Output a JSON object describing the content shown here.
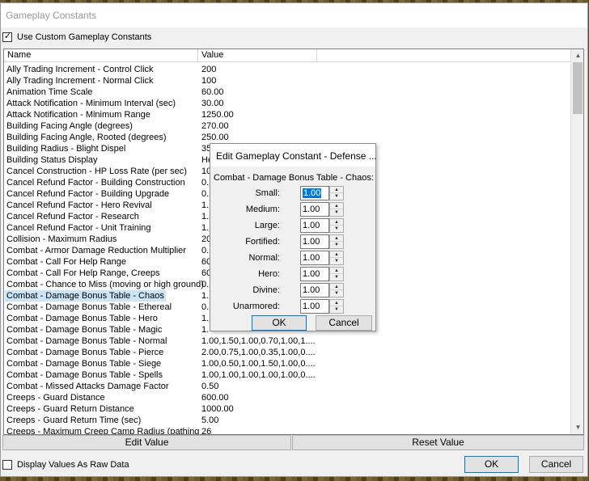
{
  "window": {
    "title": "Gameplay Constants",
    "use_custom_label": "Use Custom Gameplay Constants",
    "use_custom_checked": true,
    "raw_data_label": "Display Values As Raw Data",
    "raw_data_checked": false
  },
  "list": {
    "col_name": "Name",
    "col_value": "Value",
    "rows": [
      {
        "name": "Ally Trading Increment - Control Click",
        "value": "200"
      },
      {
        "name": "Ally Trading Increment - Normal Click",
        "value": "100"
      },
      {
        "name": "Animation Time Scale",
        "value": "60.00"
      },
      {
        "name": "Attack Notification - Minimum Interval (sec)",
        "value": "30.00"
      },
      {
        "name": "Attack Notification - Minimum Range",
        "value": "1250.00"
      },
      {
        "name": "Building Facing Angle (degrees)",
        "value": "270.00"
      },
      {
        "name": "Building Facing Angle, Rooted (degrees)",
        "value": "250.00"
      },
      {
        "name": "Building Radius - Blight Dispel",
        "value": "35"
      },
      {
        "name": "Building Status Display",
        "value": "He"
      },
      {
        "name": "Cancel Construction - HP Loss Rate (per sec)",
        "value": "10"
      },
      {
        "name": "Cancel Refund Factor - Building Construction",
        "value": "0."
      },
      {
        "name": "Cancel Refund Factor - Building Upgrade",
        "value": "0."
      },
      {
        "name": "Cancel Refund Factor - Hero Revival",
        "value": "1."
      },
      {
        "name": "Cancel Refund Factor - Research",
        "value": "1."
      },
      {
        "name": "Cancel Refund Factor - Unit Training",
        "value": "1."
      },
      {
        "name": "Collision - Maximum Radius",
        "value": "20"
      },
      {
        "name": "Combat - Armor Damage Reduction Multiplier",
        "value": "0."
      },
      {
        "name": "Combat - Call For Help Range",
        "value": "60"
      },
      {
        "name": "Combat - Call For Help Range, Creeps",
        "value": "60"
      },
      {
        "name": "Combat - Chance to Miss (moving or high ground)",
        "value": "0."
      },
      {
        "name": "Combat - Damage Bonus Table - Chaos",
        "value": "1."
      },
      {
        "name": "Combat - Damage Bonus Table - Ethereal",
        "value": "0."
      },
      {
        "name": "Combat - Damage Bonus Table - Hero",
        "value": "1."
      },
      {
        "name": "Combat - Damage Bonus Table - Magic",
        "value": "1."
      },
      {
        "name": "Combat - Damage Bonus Table - Normal",
        "value": "1.00,1.50,1.00,0.70,1.00,1...."
      },
      {
        "name": "Combat - Damage Bonus Table - Pierce",
        "value": "2.00,0.75,1.00,0.35,1.00,0...."
      },
      {
        "name": "Combat - Damage Bonus Table - Siege",
        "value": "1.00,0.50,1.00,1.50,1.00,0...."
      },
      {
        "name": "Combat - Damage Bonus Table - Spells",
        "value": "1.00,1.00,1.00,1.00,1.00,0...."
      },
      {
        "name": "Combat - Missed Attacks Damage Factor",
        "value": "0.50"
      },
      {
        "name": "Creeps - Guard Distance",
        "value": "600.00"
      },
      {
        "name": "Creeps - Guard Return Distance",
        "value": "1000.00"
      },
      {
        "name": "Creeps - Guard Return Time (sec)",
        "value": "5.00"
      },
      {
        "name": "Creeps - Maximum Creep Camp Radius (pathing",
        "value": "26"
      }
    ],
    "selected_index": 20
  },
  "buttons": {
    "edit_value": "Edit Value",
    "reset_value": "Reset Value",
    "ok": "OK",
    "cancel": "Cancel"
  },
  "dialog": {
    "title": "Edit Gameplay Constant - Defense ...",
    "heading": "Combat - Damage Bonus Table - Chaos:",
    "fields": [
      {
        "label": "Small:",
        "value": "1.00"
      },
      {
        "label": "Medium:",
        "value": "1.00"
      },
      {
        "label": "Large:",
        "value": "1.00"
      },
      {
        "label": "Fortified:",
        "value": "1.00"
      },
      {
        "label": "Normal:",
        "value": "1.00"
      },
      {
        "label": "Hero:",
        "value": "1.00"
      },
      {
        "label": "Divine:",
        "value": "1.00"
      },
      {
        "label": "Unarmored:",
        "value": "1.00"
      }
    ],
    "ok": "OK",
    "cancel": "Cancel"
  }
}
